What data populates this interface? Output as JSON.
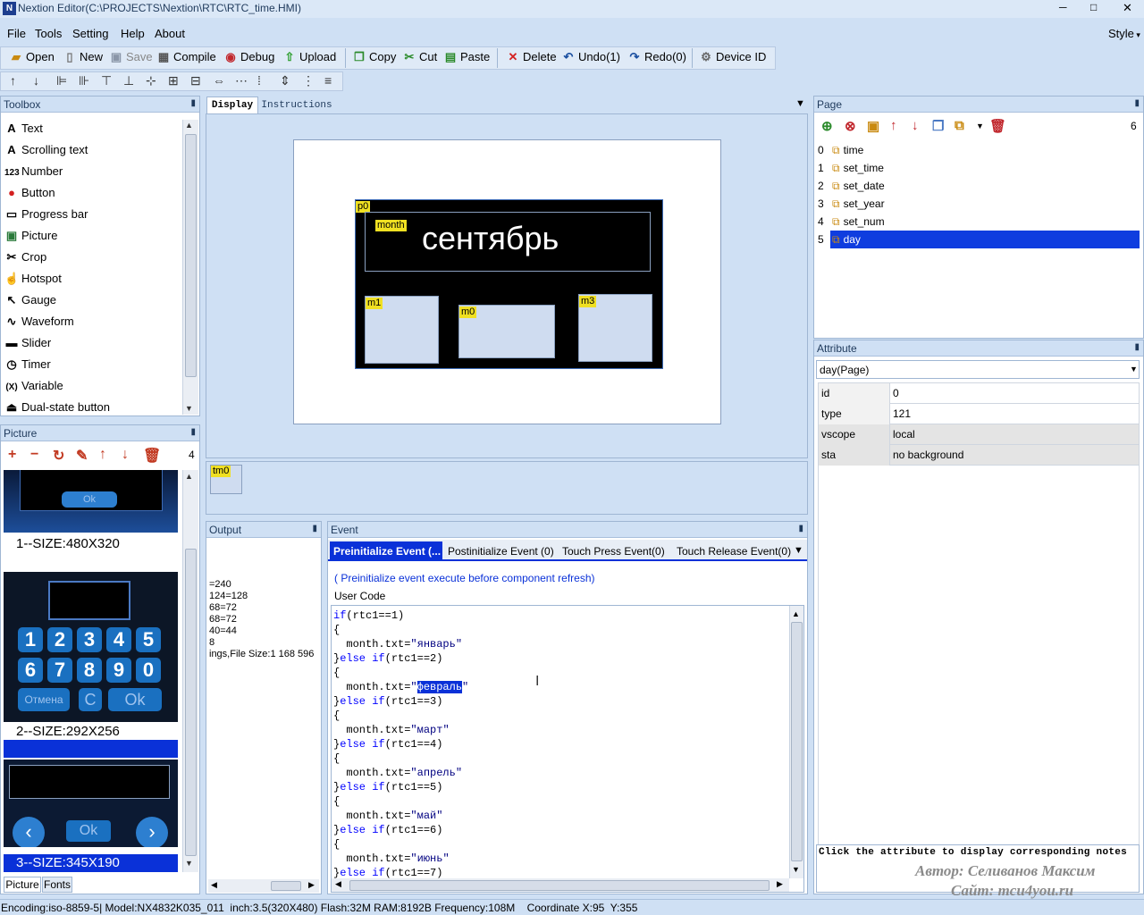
{
  "window": {
    "title": "Nextion Editor(C:\\PROJECTS\\Nextion\\RTC\\RTC_time.HMI)",
    "controls": [
      "─",
      "□",
      "✕"
    ]
  },
  "menu": {
    "items": [
      "File",
      "Tools",
      "Setting",
      "Help",
      "About"
    ],
    "style": "Style"
  },
  "toolbar": {
    "open": "Open",
    "new": "New",
    "save": "Save",
    "compile": "Compile",
    "debug": "Debug",
    "upload": "Upload",
    "copy": "Copy",
    "cut": "Cut",
    "paste": "Paste",
    "delete": "Delete",
    "undo": "Undo(1)",
    "redo": "Redo(0)",
    "device_id": "Device  ID"
  },
  "toolbox": {
    "title": "Toolbox",
    "items": [
      {
        "icon": "text-icon",
        "glyph": "A",
        "label": "Text"
      },
      {
        "icon": "scrolling-text-icon",
        "glyph": "A",
        "label": "Scrolling text"
      },
      {
        "icon": "number-icon",
        "glyph": "123",
        "label": "Number"
      },
      {
        "icon": "button-icon",
        "glyph": "●",
        "label": "Button"
      },
      {
        "icon": "progress-bar-icon",
        "glyph": "▭",
        "label": "Progress bar"
      },
      {
        "icon": "picture-icon",
        "glyph": "▣",
        "label": "Picture"
      },
      {
        "icon": "crop-icon",
        "glyph": "✂",
        "label": "Crop"
      },
      {
        "icon": "hotspot-icon",
        "glyph": "☝",
        "label": "Hotspot"
      },
      {
        "icon": "gauge-icon",
        "glyph": "↖",
        "label": "Gauge"
      },
      {
        "icon": "waveform-icon",
        "glyph": "∿",
        "label": "Waveform"
      },
      {
        "icon": "slider-icon",
        "glyph": "▬",
        "label": "Slider"
      },
      {
        "icon": "timer-icon",
        "glyph": "◷",
        "label": "Timer"
      },
      {
        "icon": "variable-icon",
        "glyph": "(X)",
        "label": "Variable"
      },
      {
        "icon": "dual-state-button-icon",
        "glyph": "⏏",
        "label": "Dual-state button"
      }
    ]
  },
  "picture_panel": {
    "title": "Picture",
    "count": "4",
    "items": [
      {
        "label": "1--SIZE:480X320",
        "ok": "Ok"
      },
      {
        "label": "2--SIZE:292X256",
        "keys": [
          "1",
          "2",
          "3",
          "4",
          "5",
          "6",
          "7",
          "8",
          "9",
          "0"
        ],
        "cancel": "Отмена",
        "c": "C",
        "ok": "Ok"
      },
      {
        "label": "3--SIZE:345X190",
        "ok": "Ok"
      }
    ],
    "tabs": [
      "Picture",
      "Fonts"
    ]
  },
  "display_tabs": [
    "Display",
    "Instructions"
  ],
  "canvas": {
    "page_label": "p0",
    "month_label": "month",
    "month_text": "сентябрь",
    "m1": "m1",
    "m0": "m0",
    "m3": "m3",
    "timer": "tm0"
  },
  "output": {
    "title": "Output",
    "lines": [
      "=240",
      "124=128",
      "68=72",
      "68=72",
      "40=44",
      "8",
      "ings,File Size:1 168 596"
    ]
  },
  "event": {
    "title": "Event",
    "tabs": [
      "Preinitialize Event (...",
      "Postinitialize Event (0)",
      "Touch Press Event(0)",
      "Touch Release Event(0)"
    ],
    "note": "( Preinitialize event execute before component refresh)",
    "user_code_label": "User Code",
    "code": [
      "if(rtc1==1)",
      "{",
      "  month.txt=\"январь\"",
      "}else if(rtc1==2)",
      "{",
      "  month.txt=\"февраль\"",
      "}else if(rtc1==3)",
      "{",
      "  month.txt=\"март\"",
      "}else if(rtc1==4)",
      "{",
      "  month.txt=\"апрель\"",
      "}else if(rtc1==5)",
      "{",
      "  month.txt=\"май\"",
      "}else if(rtc1==6)",
      "{",
      "  month.txt=\"июнь\"",
      "}else if(rtc1==7)"
    ]
  },
  "page_panel": {
    "title": "Page",
    "count": "6",
    "pages": [
      {
        "index": "0",
        "name": "time"
      },
      {
        "index": "1",
        "name": "set_time"
      },
      {
        "index": "2",
        "name": "set_date"
      },
      {
        "index": "3",
        "name": "set_year"
      },
      {
        "index": "4",
        "name": "set_num"
      },
      {
        "index": "5",
        "name": "day",
        "selected": true
      }
    ]
  },
  "attribute_panel": {
    "title": "Attribute",
    "selected": "day(Page)",
    "rows": [
      {
        "key": "id",
        "value": "0"
      },
      {
        "key": "type",
        "value": "121"
      },
      {
        "key": "vscope",
        "value": "local"
      },
      {
        "key": "sta",
        "value": "no background"
      }
    ],
    "hint": "Click the attribute to display corresponding notes"
  },
  "watermark": {
    "author": "Автор: Селиванов Максим",
    "site": "Сайт: mcu4you.ru"
  },
  "status_bar": "Encoding:iso-8859-5| Model:NX4832K035_011  inch:3.5(320X480) Flash:32M RAM:8192B Frequency:108M    Coordinate X:95  Y:355",
  "colors": {
    "accent": "#0a31d8",
    "selection": "#0f3ddf",
    "chrome": "#cfe0f4",
    "canvas_dark": "#000000"
  }
}
